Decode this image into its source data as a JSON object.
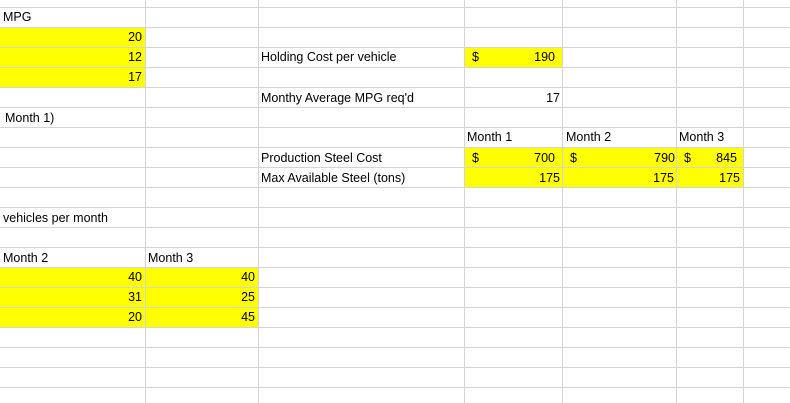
{
  "col_a": {
    "header": "MPG",
    "values": [
      "20",
      "12",
      "17"
    ],
    "note": "Month 1)",
    "caption": "vehicles per month"
  },
  "demand": {
    "month2_header": "Month 2",
    "month3_header": "Month 3",
    "month2": [
      "40",
      "31",
      "20"
    ],
    "month3": [
      "40",
      "25",
      "45"
    ]
  },
  "params": {
    "holding_label": "Holding Cost per vehicle",
    "holding_currency": "$",
    "holding_value": "190",
    "avg_mpg_label": "Monthy Average MPG req'd",
    "avg_mpg_value": "17"
  },
  "steel": {
    "months": [
      "Month 1",
      "Month 2",
      "Month 3"
    ],
    "cost_label": "Production Steel Cost",
    "cost_currency": [
      "$",
      "$",
      "$"
    ],
    "cost_values": [
      "700",
      "790",
      "845"
    ],
    "max_label": "Max Available Steel (tons)",
    "max_values": [
      "175",
      "175",
      "175"
    ]
  },
  "colors": {
    "highlight": "#ffff00",
    "gridline": "#d4d4d4"
  }
}
